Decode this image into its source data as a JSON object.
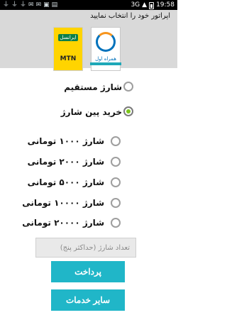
{
  "status_bar": {
    "time": "19:58",
    "left_icons": [
      "usb-icon",
      "usb-icon",
      "usb-icon",
      "chat-icon",
      "chat-icon",
      "wallet-icon",
      "folder-icon"
    ],
    "right_icons": [
      "3g-icon",
      "wifi-icon",
      "battery-icon"
    ],
    "network_label": "3G"
  },
  "operator": {
    "title": "اپراتور خود را انتخاب نمایید",
    "irancell_label": "ایرانسل",
    "mtn_label": "MTN",
    "mci_label": "همراه اول",
    "selected": "mci"
  },
  "purchase_type": {
    "options": [
      {
        "label": "شارژ مستقیم",
        "checked": false
      },
      {
        "label": "خرید پین شارژ",
        "checked": true
      }
    ]
  },
  "amounts": {
    "options": [
      {
        "label": "شارژ ۱۰۰۰ تومانی",
        "checked": false
      },
      {
        "label": "شارژ ۲۰۰۰ تومانی",
        "checked": false
      },
      {
        "label": "شارژ ۵۰۰۰ تومانی",
        "checked": false
      },
      {
        "label": "شارژ ۱۰۰۰۰ تومانی",
        "checked": false
      },
      {
        "label": "شارژ ۲۰۰۰۰ تومانی",
        "checked": false
      }
    ]
  },
  "count_input": {
    "placeholder": "تعداد شارژ (حداکثر پنج)",
    "value": ""
  },
  "buttons": {
    "pay": "پرداخت",
    "other_services": "سایر خدمات"
  },
  "colors": {
    "accent": "#20b6c8",
    "radio_checked": "#7cc61a",
    "header_bg": "#d9d9d9"
  }
}
